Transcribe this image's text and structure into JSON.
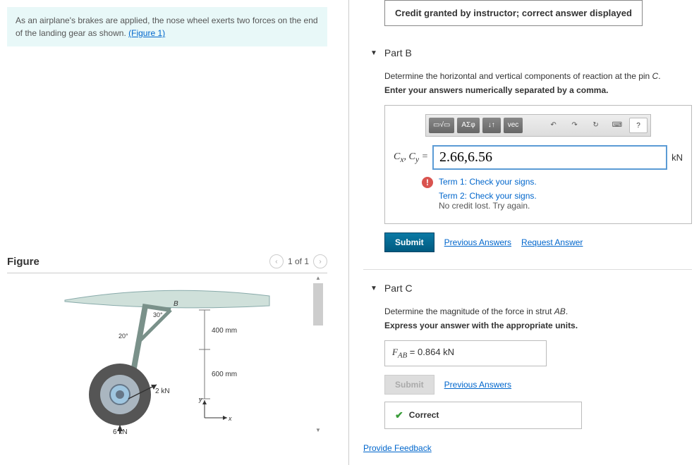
{
  "problem": {
    "text_prefix": "As an airplane's brakes are applied, the nose wheel exerts two forces on the end of the landing gear as shown.",
    "figure_link": "(Figure 1)"
  },
  "figure": {
    "title": "Figure",
    "pager": "1 of 1",
    "labels": {
      "angle1": "30°",
      "len1": "20°",
      "dim1": "400 mm",
      "dim2": "600 mm",
      "force1": "2 kN",
      "force2": "6 kN",
      "ptB": "B",
      "axis_x": "x",
      "axis_y": "y"
    }
  },
  "credit_banner": "Credit granted by instructor; correct answer displayed",
  "partB": {
    "title": "Part B",
    "instruction1_prefix": "Determine the horizontal and vertical components of reaction at the pin ",
    "instruction1_var": "C",
    "instruction1_suffix": ".",
    "instruction2": "Enter your answers numerically separated by a comma.",
    "toolbar": {
      "btn1": "▭√▭",
      "btn2": "ΑΣφ",
      "btn3": "↓↑",
      "btn4": "vec",
      "undo": "↶",
      "redo": "↷",
      "reset": "↻",
      "kbd": "⌨",
      "help": "?"
    },
    "var_label": "Cₓ, Cᵧ = ",
    "input_value": "2.66,6.56",
    "unit": "kN",
    "feedback1": "Term 1: Check your signs.",
    "feedback2": "Term 2: Check your signs.",
    "feedback3": "No credit lost. Try again.",
    "submit": "Submit",
    "prev_answers": "Previous Answers",
    "request_answer": "Request Answer"
  },
  "partC": {
    "title": "Part C",
    "instruction1_prefix": "Determine the magnitude of the force in strut ",
    "instruction1_var": "AB",
    "instruction1_suffix": ".",
    "instruction2": "Express your answer with the appropriate units.",
    "var_label": "F_AB",
    "equals": " = ",
    "value": "0.864 kN",
    "submit": "Submit",
    "prev_answers": "Previous Answers",
    "correct": "Correct"
  },
  "provide_feedback": "Provide Feedback"
}
